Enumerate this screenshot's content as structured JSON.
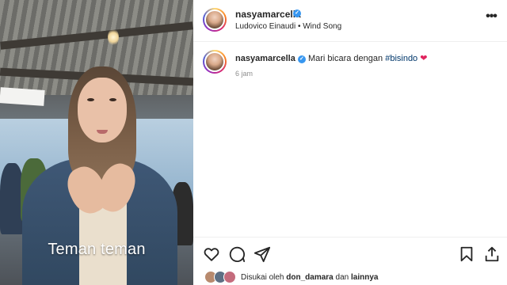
{
  "video": {
    "caption": "Teman teman"
  },
  "post": {
    "username": "nasyamarcella",
    "audio": "Ludovico Einaudi • Wind Song",
    "more_label": "•••",
    "caption": {
      "username": "nasyamarcella",
      "text": "Mari bicara dengan",
      "hashtag": "#bisindo",
      "emoji": "❤"
    },
    "time_ago": "6 jam",
    "likes": {
      "prefix": "Disukai oleh",
      "user": "don_damara",
      "joiner": "dan",
      "suffix": "lainnya"
    },
    "icons": [
      "heart-icon",
      "comment-icon",
      "share-icon",
      "save-icon",
      "verified-icon",
      "more-icon"
    ],
    "colors": {
      "verified": "#3897f0",
      "hashtag": "#00376b",
      "heart_emoji": "#e0245e",
      "secondary_text": "#8e8e8e"
    }
  }
}
